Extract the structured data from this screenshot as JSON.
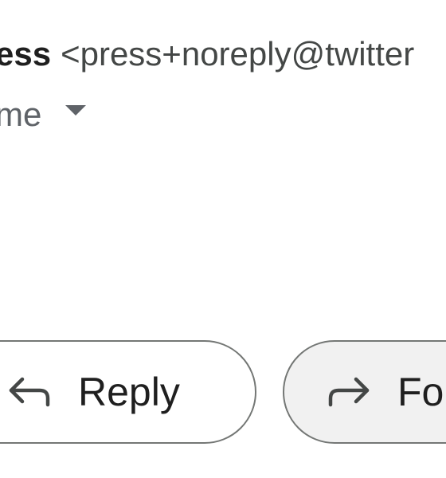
{
  "message": {
    "sender_name": "ess",
    "sender_email": "<press+noreply@twitter",
    "recipient": "me"
  },
  "actions": {
    "reply_label": "Reply",
    "forward_label": "Fo"
  },
  "icons": {
    "reply": "reply-arrow-icon",
    "forward": "forward-arrow-icon",
    "recipient_details": "caret-down-icon"
  },
  "colors": {
    "text_primary": "#1f1f1f",
    "text_secondary": "#444746",
    "outline": "#747775",
    "forward_fill": "#f1f1f1"
  }
}
